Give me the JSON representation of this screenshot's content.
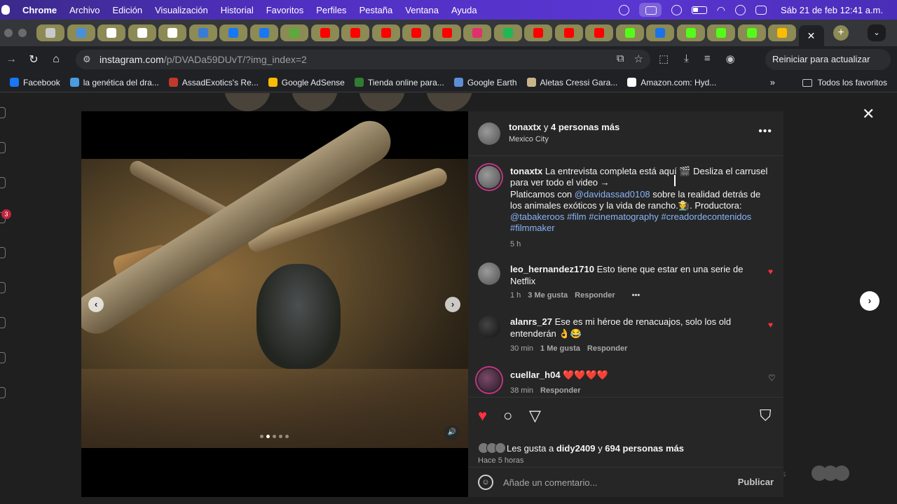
{
  "menubar": {
    "app": "Chrome",
    "items": [
      "Archivo",
      "Edición",
      "Visualización",
      "Historial",
      "Favoritos",
      "Perfiles",
      "Pestaña",
      "Ventana",
      "Ayuda"
    ],
    "clock": "Sáb 21 de feb  12:41 a.m."
  },
  "tabs": {
    "favicons": [
      {
        "icon": "generic-tab-icon",
        "color": "#c9c9c9"
      },
      {
        "icon": "cloud-icon",
        "color": "#4a90d9"
      },
      {
        "icon": "threads-icon",
        "color": "#ffffff"
      },
      {
        "icon": "threads-icon",
        "color": "#ffffff"
      },
      {
        "icon": "threads-icon",
        "color": "#ffffff"
      },
      {
        "icon": "meta-icon",
        "color": "#3a7bd5"
      },
      {
        "icon": "facebook-icon",
        "color": "#1877f2"
      },
      {
        "icon": "facebook-icon",
        "color": "#1877f2"
      },
      {
        "icon": "green-dot-icon",
        "color": "#5caa3c"
      },
      {
        "icon": "youtube-icon",
        "color": "#ff0000"
      },
      {
        "icon": "youtube-icon",
        "color": "#ff0000"
      },
      {
        "icon": "youtube-icon",
        "color": "#ff0000"
      },
      {
        "icon": "youtube-icon",
        "color": "#ff0000"
      },
      {
        "icon": "youtube-icon",
        "color": "#ff0000"
      },
      {
        "icon": "instagram-icon",
        "color": "#e1306c"
      },
      {
        "icon": "green-app-icon",
        "color": "#1db954"
      },
      {
        "icon": "youtube-icon",
        "color": "#ff0000"
      },
      {
        "icon": "youtube-icon",
        "color": "#ff0000"
      },
      {
        "icon": "youtube-icon",
        "color": "#ff0000"
      },
      {
        "icon": "kick-icon",
        "color": "#53fc18"
      },
      {
        "icon": "play-circle-icon",
        "color": "#1a73e8"
      },
      {
        "icon": "kick-icon",
        "color": "#53fc18"
      },
      {
        "icon": "kick-icon",
        "color": "#53fc18"
      },
      {
        "icon": "kick-icon",
        "color": "#53fc18"
      },
      {
        "icon": "google-drive-icon",
        "color": "#fbbc04"
      }
    ],
    "active_close": "✕",
    "new_tab": "+"
  },
  "toolbar": {
    "url_host": "instagram.com",
    "url_path": "/p/DVADa59DUvT/?img_index=2",
    "relaunch": "Reiniciar para actualizar"
  },
  "bookmarks": [
    {
      "label": "Facebook",
      "icon": "facebook-icon",
      "color": "#1877f2"
    },
    {
      "label": "la genética del dra...",
      "icon": "wordpress-icon",
      "color": "#4a9be0"
    },
    {
      "label": "AssadExotics's Re...",
      "icon": "grid-icon",
      "color": "#c0392b"
    },
    {
      "label": "Google AdSense",
      "icon": "adsense-icon",
      "color": "#fbbc04"
    },
    {
      "label": "Tienda online para...",
      "icon": "store-icon",
      "color": "#2e7d32"
    },
    {
      "label": "Google Earth",
      "icon": "earth-icon",
      "color": "#5c8fd6"
    },
    {
      "label": "Aletas Cressi Gara...",
      "icon": "fins-icon",
      "color": "#c9b48a"
    },
    {
      "label": "Amazon.com: Hyd...",
      "icon": "amazon-icon",
      "color": "#ffffff"
    }
  ],
  "bookmarks_all": "Todos los favoritos",
  "post": {
    "header_user": "tonaxtx",
    "header_joiner": "y",
    "header_others": "4 personas más",
    "location": "Mexico City",
    "caption_user": "tonaxtx",
    "caption_line1": "La entrevista completa está aquí 🎬 Desliza el carrusel para ver todo el video →",
    "caption_pre_mention": "Platicamos con",
    "caption_mention": "@davidassad0108",
    "caption_mid": "sobre la realidad detrás de los animales exóticos y la vida de rancho.🧑‍🌾. Productora:",
    "caption_tags": "@tabakeroos #film #cinematography #creadordecontenidos #filmmaker",
    "caption_time": "5 h",
    "comments": [
      {
        "user": "leo_hernandez1710",
        "text": "Esto tiene que estar en una serie de Netflix",
        "time": "1 h",
        "likes": "3 Me gusta",
        "reply": "Responder",
        "more": "•••",
        "liked": true
      },
      {
        "user": "alanrs_27",
        "text": "Ese es mi héroe de renacuajos, solo los old entenderán 👌😂",
        "time": "30 min",
        "likes": "1 Me gusta",
        "reply": "Responder",
        "liked": true
      },
      {
        "user": "cuellar_h04",
        "text": "❤️❤️❤️❤️",
        "time": "38 min",
        "reply": "Responder",
        "liked": false
      }
    ],
    "likes_prefix": "Les gusta a",
    "likes_user": "didy2409",
    "likes_joiner": "y",
    "likes_others": "694 personas más",
    "posted_ago": "Hace 5 horas",
    "comment_placeholder": "Añade un comentario...",
    "publish": "Publicar",
    "carousel_count": 5,
    "carousel_active": 2
  },
  "colors": {
    "menubar": "#4f2fc0",
    "like_red": "#ff3040",
    "link_blue": "#8ab4f8",
    "panel": "#262626"
  }
}
